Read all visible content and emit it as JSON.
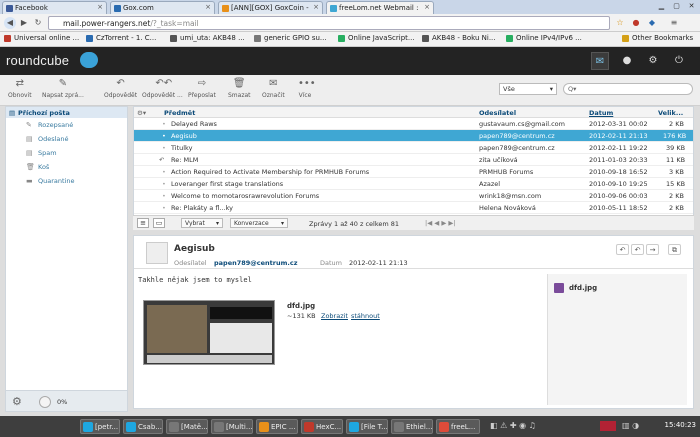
{
  "browser": {
    "tabs": [
      {
        "label": "Facebook",
        "color": "#3b5998"
      },
      {
        "label": "Gox.com",
        "color": "#2a6bb0"
      },
      {
        "label": "[ANN][GOX] GoxCoin -",
        "color": "#e8901a"
      },
      {
        "label": "freeLom.net Webmail :",
        "color": "#3fa7d3"
      }
    ],
    "url_host": "mail.power-rangers.net",
    "url_path": "/?_task=mail",
    "bookmarks": [
      "Universal online ...",
      "CzTorrent - 1. C...",
      "umi_uta: AKB48 ...",
      "generic GPIO su...",
      "Online JavaScript...",
      "AKB48 - Boku Ni...",
      "Online IPv4/IPv6 ...",
      "Other Bookmarks"
    ]
  },
  "rc": {
    "logo": "roundcube",
    "toolbar": [
      {
        "label": "Obnovit",
        "icon": "refresh-icon"
      },
      {
        "label": "Napsat zprá...",
        "icon": "compose-icon"
      },
      {
        "label": "Odpovědět",
        "icon": "reply-icon"
      },
      {
        "label": "Odpovědět ...",
        "icon": "reply-all-icon"
      },
      {
        "label": "Přeposlat",
        "icon": "forward-icon"
      },
      {
        "label": "Smazat",
        "icon": "trash-icon"
      },
      {
        "label": "Označit",
        "icon": "mark-icon"
      },
      {
        "label": "Více",
        "icon": "more-icon"
      }
    ],
    "filter_value": "Vše",
    "search_placeholder": "Q▾"
  },
  "folders": {
    "header": "Příchozí pošta",
    "items": [
      "Rozepsané",
      "Odeslané",
      "Spam",
      "Koš",
      "Quarantine"
    ],
    "quota": "0%"
  },
  "list": {
    "col_subject": "Předmět",
    "col_from": "Odesílatel",
    "col_date": "Datum",
    "col_size": "Velik...",
    "rows": [
      {
        "subject": "Delayed Raws",
        "from": "gustavaum.cs@gmail.com",
        "date": "2012-03-31 00:02",
        "size": "2 KB"
      },
      {
        "subject": "Aegisub",
        "from": "papen789@centrum.cz",
        "date": "2012-02-11 21:13",
        "size": "176 KB"
      },
      {
        "subject": "Titulky",
        "from": "papen789@centrum.cz",
        "date": "2012-02-11 19:22",
        "size": "39 KB"
      },
      {
        "subject": "Re: MLM",
        "from": "zita učíková",
        "date": "2011-01-03 20:33",
        "size": "11 KB"
      },
      {
        "subject": "Action Required to Activate Membership for PRMHUB Forums",
        "from": "PRMHUB Forums",
        "date": "2010-09-18 16:52",
        "size": "3 KB"
      },
      {
        "subject": "Loveranger first stage translations",
        "from": "Azazel",
        "date": "2010-09-10 19:25",
        "size": "15 KB"
      },
      {
        "subject": "Welcome to momotarosrawrevolution Forums",
        "from": "wrink18@msn.com",
        "date": "2010-09-06 00:03",
        "size": "2 KB"
      },
      {
        "subject": "Re: Plakáty a fl...ky",
        "from": "Helena Nováková",
        "date": "2010-05-11 18:52",
        "size": "2 KB"
      }
    ],
    "footer_select": "Vybrat",
    "footer_threads": "Konverzace",
    "footer_count": "Zprávy 1 až 40 z celkem 81"
  },
  "preview": {
    "subject": "Aegisub",
    "from_label": "Odesílatel",
    "from": "papen789@centrum.cz",
    "date_label": "Datum",
    "date": "2012-02-11 21:13",
    "body": "Takhle nějak jsem to myslel",
    "att_name": "dfd.jpg",
    "att_size": "~131 KB",
    "att_show": "Zobrazit",
    "att_download": "stáhnout",
    "att_side": "dfd.jpg"
  },
  "taskbar": {
    "items": [
      {
        "label": "[petr...",
        "color": "#1ea7e1"
      },
      {
        "label": "Csab...",
        "color": "#1ea7e1"
      },
      {
        "label": "[Matě...",
        "color": "#777"
      },
      {
        "label": "[Multi...",
        "color": "#777"
      },
      {
        "label": "EPIC ...",
        "color": "#e8901a"
      },
      {
        "label": "HexC...",
        "color": "#c0392b"
      },
      {
        "label": "[File T...",
        "color": "#1ea7e1"
      },
      {
        "label": "Ethiel...",
        "color": "#777"
      },
      {
        "label": "freeL...",
        "color": "#dd4b39"
      }
    ],
    "clock": "15:40:23"
  }
}
